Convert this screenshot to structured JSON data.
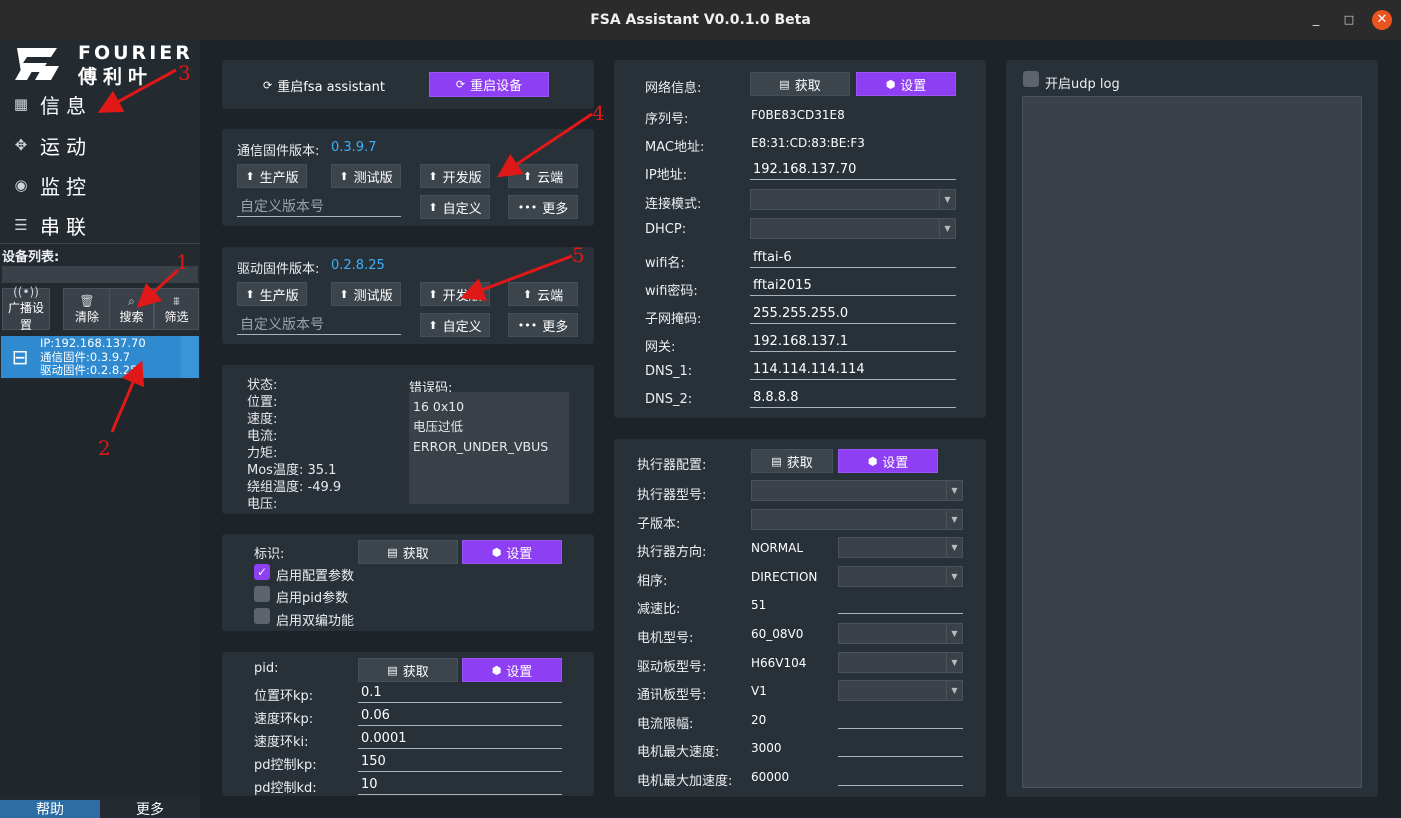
{
  "window": {
    "title": "FSA Assistant V0.0.1.0 Beta",
    "minimize": "_",
    "maximize": "□",
    "close": "✕"
  },
  "logo": {
    "brand_en": "FOURIER",
    "brand_cn": "傅利叶"
  },
  "nav": [
    {
      "label": "信息",
      "icon": "grid-icon"
    },
    {
      "label": "运动",
      "icon": "motion-icon"
    },
    {
      "label": "监控",
      "icon": "monitor-icon"
    },
    {
      "label": "串联",
      "icon": "chain-icon"
    }
  ],
  "device_list": {
    "title": "设备列表:",
    "tools": [
      "广播设置",
      "清除",
      "搜索",
      "筛选"
    ],
    "device": {
      "ip": "IP:192.168.137.70",
      "comm": "通信固件:0.3.9.7",
      "drive": "驱动固件:0.2.8.25"
    }
  },
  "bottom_tabs": {
    "help": "帮助",
    "more": "更多"
  },
  "restart": {
    "fsa": "重启fsa assistant",
    "device": "重启设备"
  },
  "comm_fw": {
    "label": "通信固件版本:",
    "version": "0.3.9.7",
    "btn_prod": "生产版",
    "btn_test": "测试版",
    "btn_dev": "开发版",
    "btn_cloud": "云端",
    "custom_placeholder": "自定义版本号",
    "btn_custom": "自定义",
    "btn_more": "更多"
  },
  "drive_fw": {
    "label": "驱动固件版本:",
    "version": "0.2.8.25",
    "btn_prod": "生产版",
    "btn_test": "测试版",
    "btn_dev": "开发版",
    "btn_cloud": "云端",
    "custom_placeholder": "自定义版本号",
    "btn_custom": "自定义",
    "btn_more": "更多"
  },
  "status": {
    "state_label": "状态:",
    "pos_label": "位置:",
    "vel_label": "速度:",
    "cur_label": "电流:",
    "torque_label": "力矩:",
    "mos_label": "Mos温度:",
    "mos_val": "35.1",
    "winding_label": "绕组温度:",
    "winding_val": "-49.9",
    "volt_label": "电压:",
    "error_label": "错误码:",
    "error_lines": [
      "16 0x10",
      "电压过低",
      "ERROR_UNDER_VBUS"
    ]
  },
  "flags": {
    "label": "标识:",
    "get": "获取",
    "set": "设置",
    "cfg": "启用配置参数",
    "cfg_checked": true,
    "pid": "启用pid参数",
    "pid_checked": false,
    "dual": "启用双编功能",
    "dual_checked": false
  },
  "pid": {
    "label": "pid:",
    "get": "获取",
    "set": "设置",
    "rows": [
      {
        "label": "位置环kp:",
        "value": "0.1"
      },
      {
        "label": "速度环kp:",
        "value": "0.06"
      },
      {
        "label": "速度环ki:",
        "value": "0.0001"
      },
      {
        "label": "pd控制kp:",
        "value": "150"
      },
      {
        "label": "pd控制kd:",
        "value": "10"
      }
    ]
  },
  "network": {
    "label": "网络信息:",
    "get": "获取",
    "set": "设置",
    "serial_label": "序列号:",
    "serial": "F0BE83CD31E8",
    "mac_label": "MAC地址:",
    "mac": "E8:31:CD:83:BE:F3",
    "ip_label": "IP地址:",
    "ip": "192.168.137.70",
    "mode_label": "连接模式:",
    "dhcp_label": "DHCP:",
    "ssid_label": "wifi名:",
    "ssid": "fftai-6",
    "pwd_label": "wifi密码:",
    "pwd": "fftai2015",
    "mask_label": "子网掩码:",
    "mask": "255.255.255.0",
    "gw_label": "网关:",
    "gw": "192.168.137.1",
    "dns1_label": "DNS_1:",
    "dns1": "114.114.114.114",
    "dns2_label": "DNS_2:",
    "dns2": "8.8.8.8"
  },
  "actuator": {
    "label": "执行器配置:",
    "get": "获取",
    "set": "设置",
    "rows": [
      {
        "label": "执行器型号:",
        "value": "",
        "ctrl": "combo-wide"
      },
      {
        "label": "子版本:",
        "value": "",
        "ctrl": "combo-wide"
      },
      {
        "label": "执行器方向:",
        "value": "NORMAL",
        "ctrl": "combo"
      },
      {
        "label": "相序:",
        "value": "DIRECTION",
        "ctrl": "combo"
      },
      {
        "label": "减速比:",
        "value": "51",
        "ctrl": "input"
      },
      {
        "label": "电机型号:",
        "value": "60_08V0",
        "ctrl": "combo"
      },
      {
        "label": "驱动板型号:",
        "value": "H66V104",
        "ctrl": "combo"
      },
      {
        "label": "通讯板型号:",
        "value": "V1",
        "ctrl": "combo"
      },
      {
        "label": "电流限幅:",
        "value": "20",
        "ctrl": "input"
      },
      {
        "label": "电机最大速度:",
        "value": "3000",
        "ctrl": "input"
      },
      {
        "label": "电机最大加速度:",
        "value": "60000",
        "ctrl": "input"
      }
    ]
  },
  "udp": {
    "label": "开启udp log",
    "checked": false
  },
  "annotations": [
    "1",
    "2",
    "3",
    "4",
    "5"
  ]
}
